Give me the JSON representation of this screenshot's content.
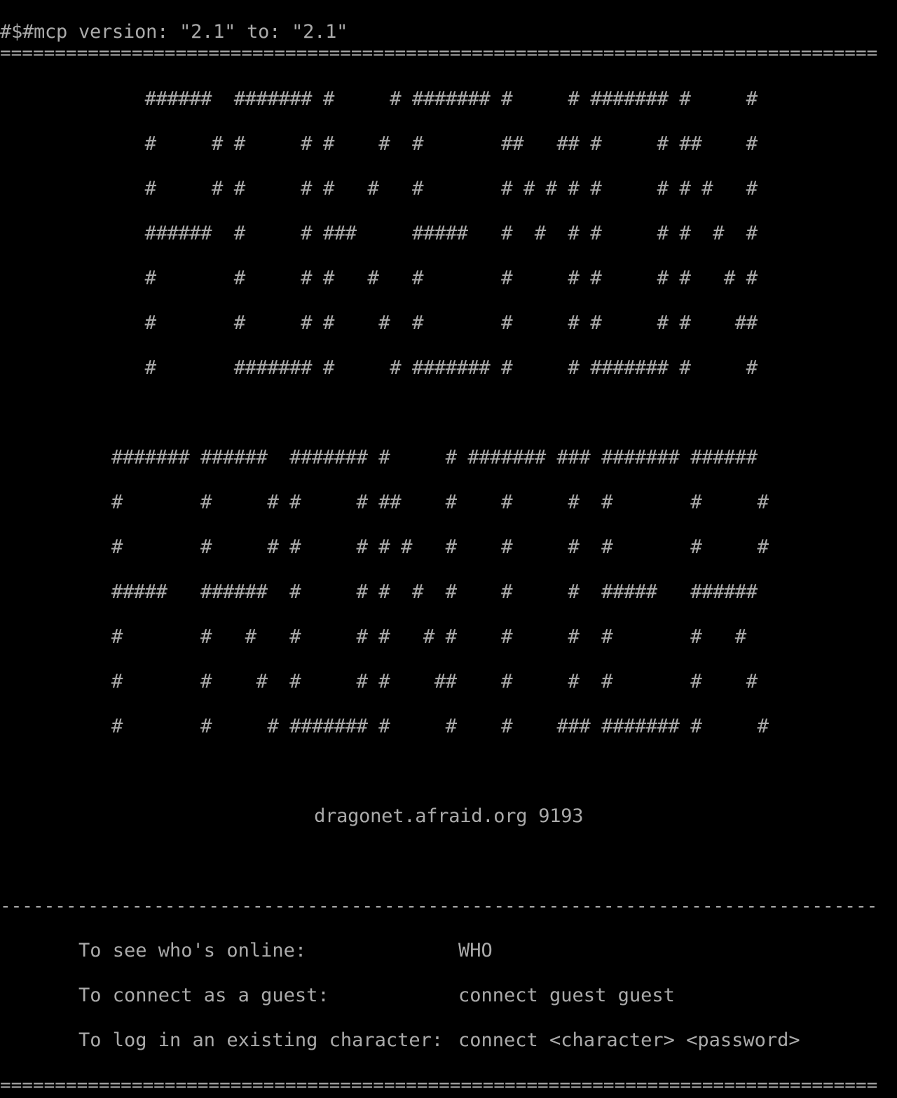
{
  "terminal": {
    "header": "#$#mcp version: \"2.1\" to: \"2.1\"",
    "rule_double": "================================================================================",
    "rule_dash": "--------------------------------------------------------------------------------",
    "banner_top": "             ######  ####### #     # ####### #     # ####### #     #\n             #     # #     # #    #  #       ##   ## #     # ##    #\n             #     # #     # #   #   #       # # # # #     # # #   #\n             ######  #     # ###     #####   #  #  # #     # #  #  #\n             #       #     # #   #   #       #     # #     # #   # #\n             #       #     # #    #  #       #     # #     # #    ##\n             #       ####### #     # ####### #     # ####### #     #",
    "banner_bottom": "          ####### ######  ####### #     # ####### ### ####### ######\n          #       #     # #     # ##    #    #     #  #       #     #\n          #       #     # #     # # #   #    #     #  #       #     #\n          #####   ######  #     # #  #  #    #     #  #####   ######\n          #       #   #   #     # #   # #    #     #  #       #   #\n          #       #    #  #     # #    ##    #     #  #       #    #\n          #       #     # ####### #     #    #    ### ####### #     #",
    "host": "                            dragonet.afraid.org 9193",
    "instructions": [
      {
        "label": "To see who's online:",
        "command": "WHO"
      },
      {
        "label": "To connect as a guest:",
        "command": "connect guest guest"
      },
      {
        "label": "To log in an existing character:",
        "command": "connect <character> <password>"
      }
    ]
  }
}
